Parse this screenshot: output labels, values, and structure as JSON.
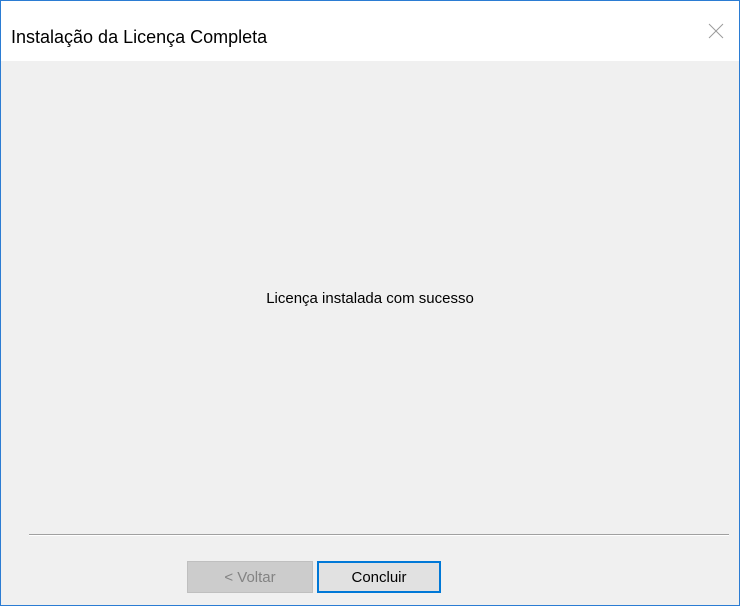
{
  "window": {
    "title": "Instalação da Licença Completa"
  },
  "content": {
    "message": "Licença instalada com sucesso"
  },
  "buttons": {
    "back_label": "< Voltar",
    "finish_label": "Concluir"
  },
  "icons": {
    "close": "close-icon"
  },
  "colors": {
    "accent": "#0078d7",
    "window_border": "#2b7cd3",
    "dialog_background": "#f0f0f0",
    "disabled_text": "#838383"
  }
}
